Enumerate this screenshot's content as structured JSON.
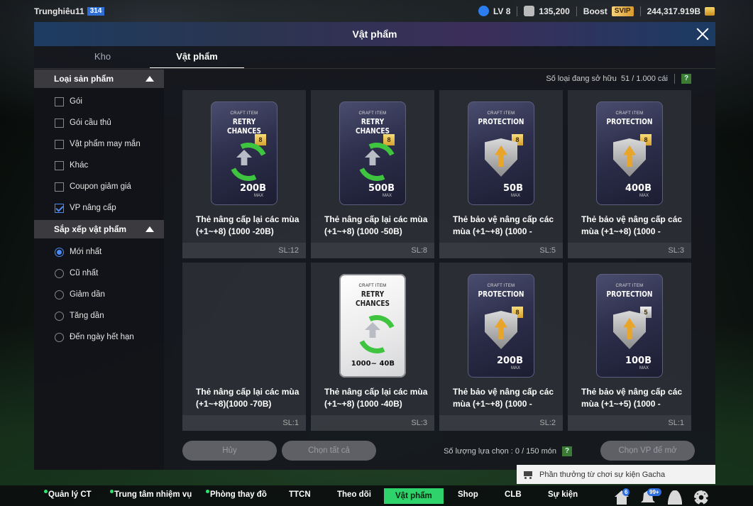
{
  "user": {
    "name": "Trunghiêu11",
    "id_badge": "314"
  },
  "stats": {
    "level": "LV 8",
    "team_value": "135,200",
    "boost_label": "Boost",
    "vip": "SVIP",
    "coins": "244,317.919B"
  },
  "modal": {
    "title": "Vật phẩm",
    "tabs": [
      "Kho",
      "Vật phẩm"
    ],
    "active_tab": "Vật phẩm"
  },
  "filters": {
    "product_type_header": "Loại sản phẩm",
    "product_types": [
      {
        "label": "Gói",
        "checked": false
      },
      {
        "label": "Gói cầu thủ",
        "checked": false
      },
      {
        "label": "Vật phẩm may mắn",
        "checked": false
      },
      {
        "label": "Khác",
        "checked": false
      },
      {
        "label": "Coupon giảm giá",
        "checked": false
      },
      {
        "label": "VP nâng cấp",
        "checked": true
      }
    ],
    "sort_header": "Sắp xếp vật phẩm",
    "sort_options": [
      {
        "label": "Mới nhất",
        "selected": true
      },
      {
        "label": "Cũ nhất",
        "selected": false
      },
      {
        "label": "Giảm dần",
        "selected": false
      },
      {
        "label": "Tăng dần",
        "selected": false
      },
      {
        "label": "Đến ngày hết hạn",
        "selected": false
      }
    ]
  },
  "owned": {
    "label": "Số loại đang sở hữu",
    "value": "51 / 1.000 cái",
    "help": "?"
  },
  "items": [
    {
      "kind": "retry",
      "style": "dark",
      "small": "CRAFT ITEM",
      "title": "RETRY CHANCES",
      "badge": "8",
      "value": "200B",
      "max": "MAX",
      "name": "Thẻ nâng cấp lại các mùa (+1~+8) (1000 -20B)",
      "qty": "SL:12"
    },
    {
      "kind": "retry",
      "style": "dark",
      "small": "CRAFT ITEM",
      "title": "RETRY CHANCES",
      "badge": "8",
      "value": "500B",
      "max": "MAX",
      "name": "Thẻ nâng cấp lại các mùa (+1~+8) (1000 -50B)",
      "qty": "SL:8"
    },
    {
      "kind": "protect",
      "style": "dark",
      "small": "CRAFT ITEM",
      "title": "PROTECTION",
      "badge": "8",
      "value": "50B",
      "max": "MAX",
      "name": "Thẻ bảo vệ nâng cấp các mùa (+1~+8) (1000 -",
      "qty": "SL:5"
    },
    {
      "kind": "protect",
      "style": "dark",
      "small": "CRAFT ITEM",
      "title": "PROTECTION",
      "badge": "8",
      "value": "400B",
      "max": "MAX",
      "name": "Thẻ bảo vệ nâng cấp các mùa (+1~+8) (1000 -",
      "qty": "SL:3"
    },
    {
      "kind": "empty",
      "style": "none",
      "small": "",
      "title": "",
      "badge": "",
      "value": "",
      "max": "",
      "name": "Thẻ nâng cấp lại các mùa (+1~+8)(1000 -70B)",
      "qty": "SL:1"
    },
    {
      "kind": "retry",
      "style": "white",
      "small": "CRAFT ITEM",
      "title": "RETRY CHANCES",
      "badge": "",
      "value": "1000~ 40B",
      "max": "",
      "name": "Thẻ nâng cấp lại các mùa (+1~+8) (1000 -40B)",
      "qty": "SL:3"
    },
    {
      "kind": "protect",
      "style": "dark",
      "small": "CRAFT ITEM",
      "title": "PROTECTION",
      "badge": "8",
      "value": "200B",
      "max": "MAX",
      "name": "Thẻ bảo vệ nâng cấp các mùa (+1~+8) (1000 -",
      "qty": "SL:2"
    },
    {
      "kind": "protect",
      "style": "dark",
      "small": "CRAFT ITEM",
      "title": "PROTECTION",
      "badge": "5",
      "value": "100B",
      "max": "MAX",
      "name": "Thẻ bảo vệ nâng cấp các mùa (+1~+5) (1000 -",
      "qty": "SL:1"
    }
  ],
  "actions": {
    "cancel": "Hủy",
    "select_all": "Chọn tất cả",
    "select_count_label": "Số lượng lựa chọn : 0 / 150 món",
    "help": "?",
    "open": "Chọn VP để mở"
  },
  "event_banner": "Phần thưởng từ chơi sự kiện Gacha",
  "bottom_nav": {
    "items": [
      "Quản lý CT",
      "Trung tâm nhiệm vụ",
      "Phòng thay đồ",
      "TTCN",
      "Theo dõi",
      "Vật phẩm",
      "Shop",
      "CLB",
      "Sự kiện"
    ],
    "active": "Vật phẩm",
    "home_badge": "6",
    "bell_badge": "99+"
  },
  "colors": {
    "accent_green": "#2ed36b",
    "check_blue": "#4b8bf5",
    "svip_gold": "#d89a2e"
  }
}
